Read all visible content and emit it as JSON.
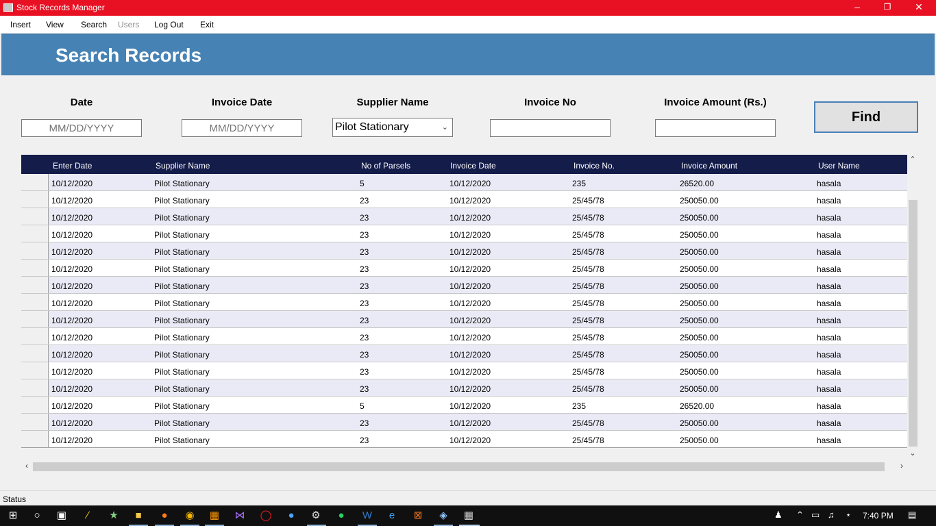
{
  "window": {
    "title": "Stock Records Manager",
    "minimize": "–",
    "restore": "❐",
    "close": "✕"
  },
  "menu": [
    "Insert",
    "View",
    "Search",
    "Users",
    "Log Out",
    "Exit"
  ],
  "header": {
    "title": "Search Records"
  },
  "search": {
    "date_label": "Date",
    "date_placeholder": "MM/DD/YYYY",
    "invoice_date_label": "Invoice Date",
    "invoice_date_placeholder": "MM/DD/YYYY",
    "supplier_label": "Supplier Name",
    "supplier_value": "Pilot Stationary",
    "invoice_no_label": "Invoice No",
    "invoice_no_value": "",
    "amount_label": "Invoice Amount (Rs.)",
    "amount_value": "",
    "find_label": "Find"
  },
  "grid": {
    "columns": [
      "Enter Date",
      "Supplier Name",
      "No of Parsels",
      "Invoice Date",
      "Invoice No.",
      "Invoice Amount",
      "User Name"
    ],
    "rows": [
      [
        "10/12/2020",
        "Pilot Stationary",
        "5",
        "10/12/2020",
        "235",
        "26520.00",
        "hasala"
      ],
      [
        "10/12/2020",
        "Pilot Stationary",
        "23",
        "10/12/2020",
        "25/45/78",
        "250050.00",
        "hasala"
      ],
      [
        "10/12/2020",
        "Pilot Stationary",
        "23",
        "10/12/2020",
        "25/45/78",
        "250050.00",
        "hasala"
      ],
      [
        "10/12/2020",
        "Pilot Stationary",
        "23",
        "10/12/2020",
        "25/45/78",
        "250050.00",
        "hasala"
      ],
      [
        "10/12/2020",
        "Pilot Stationary",
        "23",
        "10/12/2020",
        "25/45/78",
        "250050.00",
        "hasala"
      ],
      [
        "10/12/2020",
        "Pilot Stationary",
        "23",
        "10/12/2020",
        "25/45/78",
        "250050.00",
        "hasala"
      ],
      [
        "10/12/2020",
        "Pilot Stationary",
        "23",
        "10/12/2020",
        "25/45/78",
        "250050.00",
        "hasala"
      ],
      [
        "10/12/2020",
        "Pilot Stationary",
        "23",
        "10/12/2020",
        "25/45/78",
        "250050.00",
        "hasala"
      ],
      [
        "10/12/2020",
        "Pilot Stationary",
        "23",
        "10/12/2020",
        "25/45/78",
        "250050.00",
        "hasala"
      ],
      [
        "10/12/2020",
        "Pilot Stationary",
        "23",
        "10/12/2020",
        "25/45/78",
        "250050.00",
        "hasala"
      ],
      [
        "10/12/2020",
        "Pilot Stationary",
        "23",
        "10/12/2020",
        "25/45/78",
        "250050.00",
        "hasala"
      ],
      [
        "10/12/2020",
        "Pilot Stationary",
        "23",
        "10/12/2020",
        "25/45/78",
        "250050.00",
        "hasala"
      ],
      [
        "10/12/2020",
        "Pilot Stationary",
        "23",
        "10/12/2020",
        "25/45/78",
        "250050.00",
        "hasala"
      ],
      [
        "10/12/2020",
        "Pilot Stationary",
        "5",
        "10/12/2020",
        "235",
        "26520.00",
        "hasala"
      ],
      [
        "10/12/2020",
        "Pilot Stationary",
        "23",
        "10/12/2020",
        "25/45/78",
        "250050.00",
        "hasala"
      ],
      [
        "10/12/2020",
        "Pilot Stationary",
        "23",
        "10/12/2020",
        "25/45/78",
        "250050.00",
        "hasala"
      ]
    ]
  },
  "status": {
    "text": "Status"
  },
  "taskbar": {
    "clock": "7:40 PM",
    "apps": [
      "start-icon",
      "search-icon",
      "task-view-icon",
      "app-icon",
      "app-icon",
      "file-explorer-icon",
      "firefox-icon",
      "chrome-icon",
      "sublime-icon",
      "visual-studio-icon",
      "opera-icon",
      "firefox-dev-icon",
      "settings-icon",
      "whatsapp-icon",
      "word-icon",
      "edge-icon",
      "xampp-icon",
      "paint-icon",
      "stock-manager-icon"
    ]
  },
  "colors": {
    "titlebar": "#e81123",
    "header": "#4682b4",
    "grid_header": "#141c4a",
    "row_alt": "#eaeaf6"
  }
}
